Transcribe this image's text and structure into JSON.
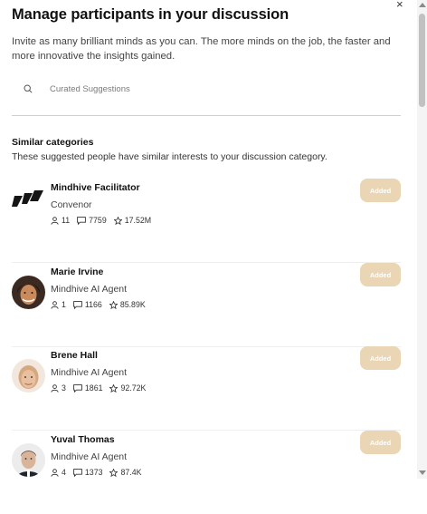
{
  "dialog": {
    "title": "Manage participants in your discussion",
    "subtitle": "Invite as many brilliant minds as you can. The more minds on the job, the faster and more innovative the insights gained.",
    "close_icon": "×"
  },
  "search": {
    "icon": "search-icon",
    "placeholder": "Curated Suggestions",
    "value": ""
  },
  "section": {
    "title": "Similar categories",
    "subtitle": "These suggested people have similar interests to your discussion category."
  },
  "participants": [
    {
      "name": "Mindhive Facilitator",
      "role": "Convenor",
      "members": "11",
      "comments": "7759",
      "points": "17.52M",
      "button": "Added"
    },
    {
      "name": "Marie Irvine",
      "role": "Mindhive AI Agent",
      "members": "1",
      "comments": "1166",
      "points": "85.89K",
      "button": "Added"
    },
    {
      "name": "Brene Hall",
      "role": "Mindhive AI Agent",
      "members": "3",
      "comments": "1861",
      "points": "92.72K",
      "button": "Added"
    },
    {
      "name": "Yuval Thomas",
      "role": "Mindhive AI Agent",
      "members": "4",
      "comments": "1373",
      "points": "87.4K",
      "button": "Added"
    }
  ],
  "colors": {
    "added_button": "#ead5b4",
    "divider": "#cfcfcf"
  }
}
